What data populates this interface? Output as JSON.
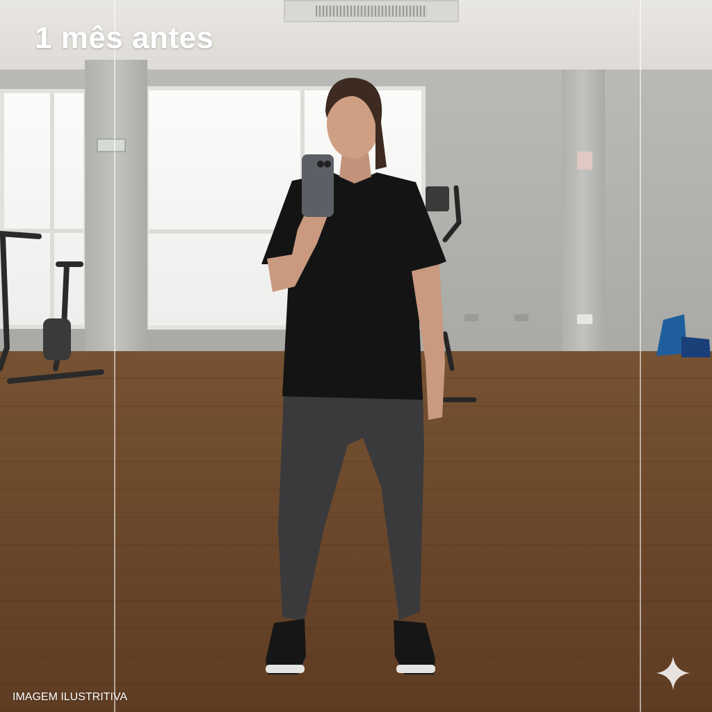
{
  "headline": "1 mês antes",
  "watermark": "IMAGEM ILUSTRITIVA",
  "sparkle_icon": "sparkle-icon",
  "colors": {
    "headline_text": "#ffffff",
    "shirt": "#141414",
    "leggings": "#3a3a3c",
    "floor": "#a88a6b",
    "wall": "#b5b6b1"
  }
}
